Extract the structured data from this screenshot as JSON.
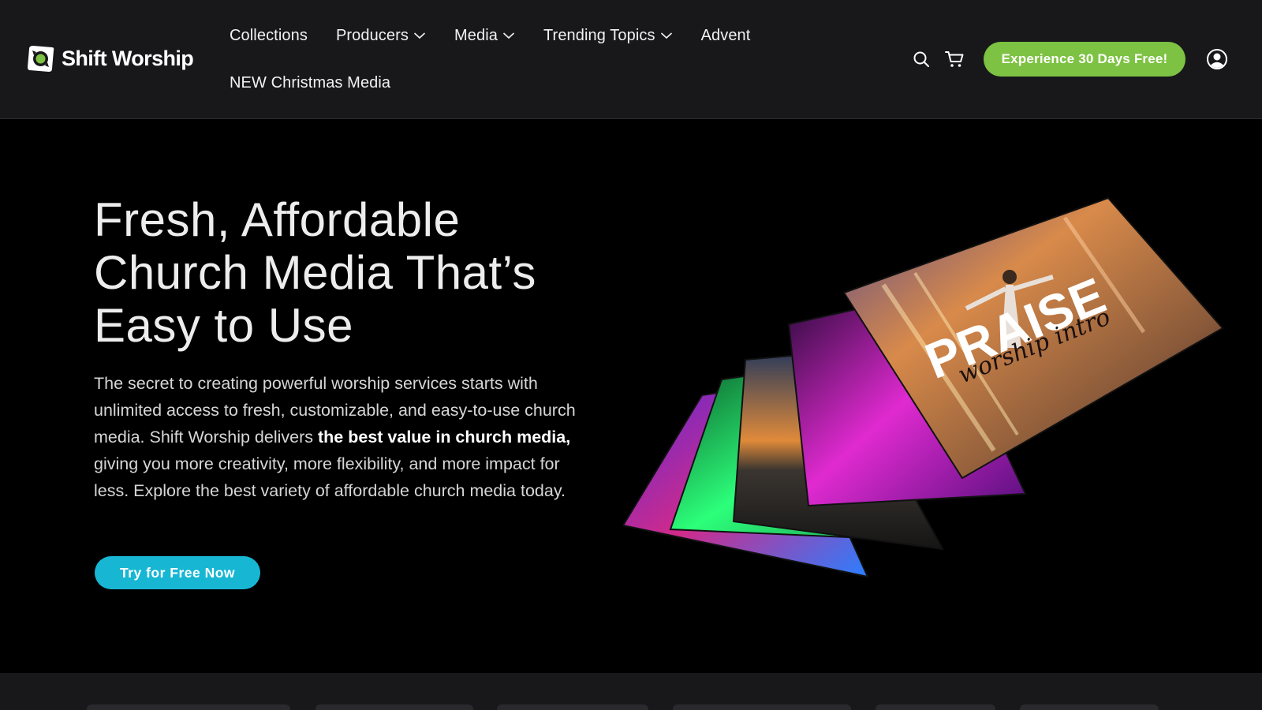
{
  "brand": {
    "name": "Shift Worship",
    "accent_green": "#7dc242",
    "accent_cyan": "#17b7d4"
  },
  "nav": {
    "items": [
      {
        "label": "Collections",
        "dropdown": false
      },
      {
        "label": "Producers",
        "dropdown": true
      },
      {
        "label": "Media",
        "dropdown": true
      },
      {
        "label": "Trending Topics",
        "dropdown": true
      },
      {
        "label": "Advent",
        "dropdown": false
      },
      {
        "label": "NEW Christmas Media",
        "dropdown": false
      }
    ]
  },
  "header_actions": {
    "search_icon": "search-icon",
    "cart_icon": "cart-icon",
    "cta_label": "Experience 30 Days Free!",
    "account_icon": "account-icon"
  },
  "hero": {
    "title_line1": "Fresh, Affordable",
    "title_line2": "Church Media That’s",
    "title_line3": "Easy to Use",
    "body_part1": "The secret to creating powerful worship services starts with unlimited access to fresh, customizable, and easy-to-use church media. Shift Worship delivers ",
    "body_bold": "the best value in church media,",
    "body_part2": " giving you more creativity, more flexibility, and more impact for less. Explore the best variety of affordable church media today.",
    "cta_label": "Try for Free Now",
    "featured_card_title": "PRAISE",
    "featured_card_subtitle": "worship intro"
  }
}
